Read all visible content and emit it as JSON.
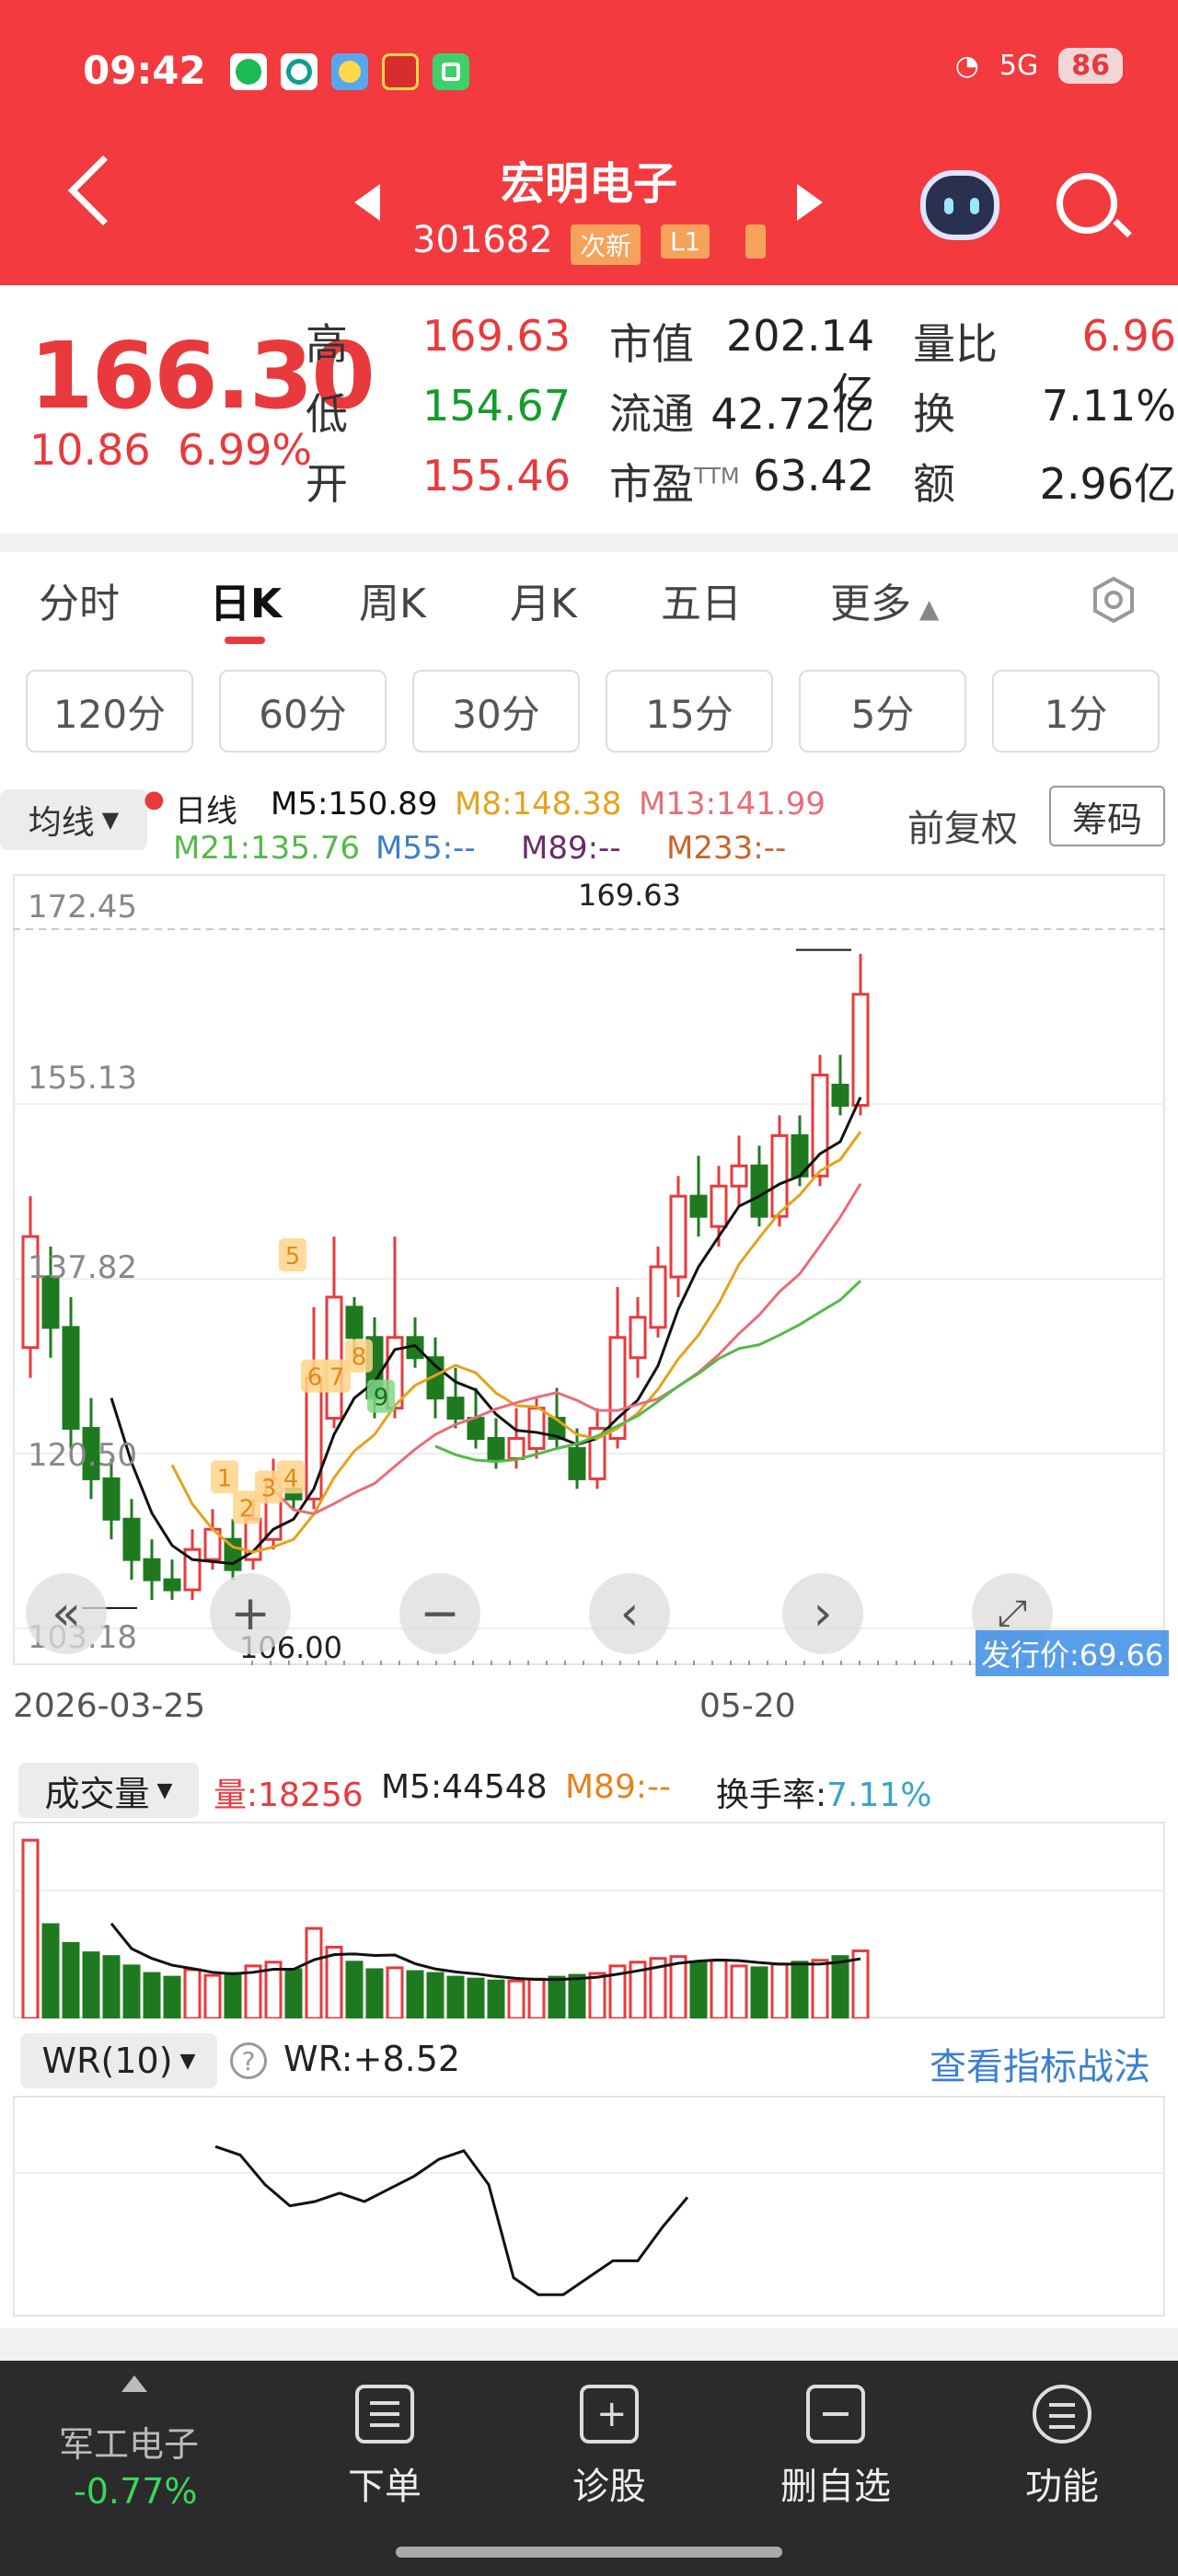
{
  "status_bar": {
    "time": "09:42",
    "signal": "5G",
    "battery": "86"
  },
  "header": {
    "stock_name": "宏明电子",
    "stock_code": "301682",
    "tags": [
      "次新",
      "L1"
    ]
  },
  "quote": {
    "price": "166.30",
    "change": "10.86",
    "change_pct": "6.99%",
    "high_label": "高",
    "high": "169.63",
    "low_label": "低",
    "low": "154.67",
    "open_label": "开",
    "open": "155.46",
    "mktcap_label": "市值",
    "mktcap": "202.14亿",
    "float_label": "流通",
    "float": "42.72亿",
    "pe_label": "市盈",
    "pe_sup": "TTM",
    "pe": "63.42",
    "volratio_label": "量比",
    "volratio": "6.96",
    "turnover_label": "换",
    "turnover": "7.11%",
    "amount_label": "额",
    "amount": "2.96亿"
  },
  "tabs": [
    "分时",
    "日K",
    "周K",
    "月K",
    "五日",
    "更多"
  ],
  "periods": [
    "120分",
    "60分",
    "30分",
    "15分",
    "5分",
    "1分"
  ],
  "kline": {
    "ma_button": "均线",
    "legend_day": "日线",
    "m5": "M5:150.89",
    "m8": "M8:148.38",
    "m13": "M13:141.99",
    "m21": "M21:135.76",
    "m55": "M55:--",
    "m89": "M89:--",
    "m233": "M233:--",
    "fuquan": "前复权",
    "chouma": "筹码",
    "y_labels": [
      "172.45",
      "155.13",
      "137.82",
      "120.50",
      "103.18"
    ],
    "high_mark": "169.63",
    "low_mark": "106.00",
    "date_start": "2026-03-25",
    "date_end": "05-20",
    "issue_price": "发行价:69.66",
    "markers": [
      "1",
      "2",
      "3",
      "4",
      "5",
      "6",
      "7",
      "8",
      "9"
    ],
    "colors": {
      "up": "#e83a3d",
      "down": "#1f7a1f",
      "m5": "#111111",
      "m8": "#e6a21b",
      "m13": "#e86d7a",
      "m21": "#55b94a"
    }
  },
  "volume": {
    "select": "成交量",
    "vol": "量:18256",
    "m5": "M5:44548",
    "m89": "M89:--",
    "turnover_label": "换手率:",
    "turnover": "7.11%"
  },
  "wr": {
    "select": "WR(10)",
    "value": "WR:+8.52",
    "link": "查看指标战法"
  },
  "bottom_bar": {
    "sector": "军工电子",
    "sector_change": "-0.77%",
    "items": [
      "下单",
      "诊股",
      "删自选",
      "功能"
    ]
  },
  "chart_data": {
    "type": "candlestick",
    "ylim": [
      103.18,
      172.45
    ],
    "y_ticks": [
      172.45,
      155.13,
      137.82,
      120.5,
      103.18
    ],
    "candles": [
      [
        131,
        142,
        128,
        146
      ],
      [
        138,
        133,
        130,
        141
      ],
      [
        133,
        123,
        121,
        136
      ],
      [
        123,
        118,
        116,
        126
      ],
      [
        118,
        114,
        112,
        120
      ],
      [
        114,
        110,
        108,
        116
      ],
      [
        110,
        108,
        106,
        112
      ],
      [
        108,
        107,
        106,
        110
      ],
      [
        107,
        111,
        106,
        113
      ],
      [
        110,
        113,
        109,
        115
      ],
      [
        112,
        109,
        108,
        114
      ],
      [
        110,
        114,
        109,
        116
      ],
      [
        112,
        118,
        111,
        120
      ],
      [
        117,
        116,
        115,
        119
      ],
      [
        116,
        128,
        115,
        135
      ],
      [
        124,
        136,
        123,
        142
      ],
      [
        135,
        132,
        130,
        136
      ],
      [
        132,
        126,
        124,
        134
      ],
      [
        125,
        132,
        124,
        142
      ],
      [
        132,
        130,
        129,
        134
      ],
      [
        130,
        126,
        124,
        132
      ],
      [
        126,
        124,
        123,
        129
      ],
      [
        124,
        122,
        121,
        127
      ],
      [
        122,
        120,
        119,
        124
      ],
      [
        120,
        122,
        119,
        125
      ],
      [
        121,
        125,
        120,
        126
      ],
      [
        124,
        122,
        121,
        127
      ],
      [
        121,
        118,
        117,
        123
      ],
      [
        118,
        123,
        117,
        125
      ],
      [
        122,
        132,
        121,
        137
      ],
      [
        130,
        134,
        128,
        136
      ],
      [
        133,
        139,
        132,
        141
      ],
      [
        138,
        146,
        136,
        148
      ],
      [
        146,
        144,
        142,
        150
      ],
      [
        143,
        147,
        141,
        149
      ],
      [
        147,
        149,
        145,
        152
      ],
      [
        149,
        144,
        143,
        151
      ],
      [
        144,
        152,
        143,
        154
      ],
      [
        152,
        148,
        147,
        154
      ],
      [
        148,
        158,
        147,
        160
      ],
      [
        157,
        155,
        154,
        160
      ],
      [
        155,
        166,
        154,
        170
      ]
    ],
    "volume": [
      95,
      50,
      40,
      35,
      33,
      28,
      24,
      22,
      26,
      23,
      24,
      28,
      30,
      26,
      48,
      38,
      30,
      26,
      27,
      25,
      24,
      22,
      21,
      20,
      20,
      21,
      22,
      23,
      24,
      28,
      30,
      32,
      33,
      30,
      31,
      28,
      27,
      29,
      30,
      31,
      33,
      36
    ],
    "wr": [
      24,
      28,
      42,
      52,
      50,
      46,
      50,
      44,
      38,
      30,
      26,
      42,
      86,
      94,
      94,
      86,
      78,
      78,
      62,
      48
    ]
  }
}
